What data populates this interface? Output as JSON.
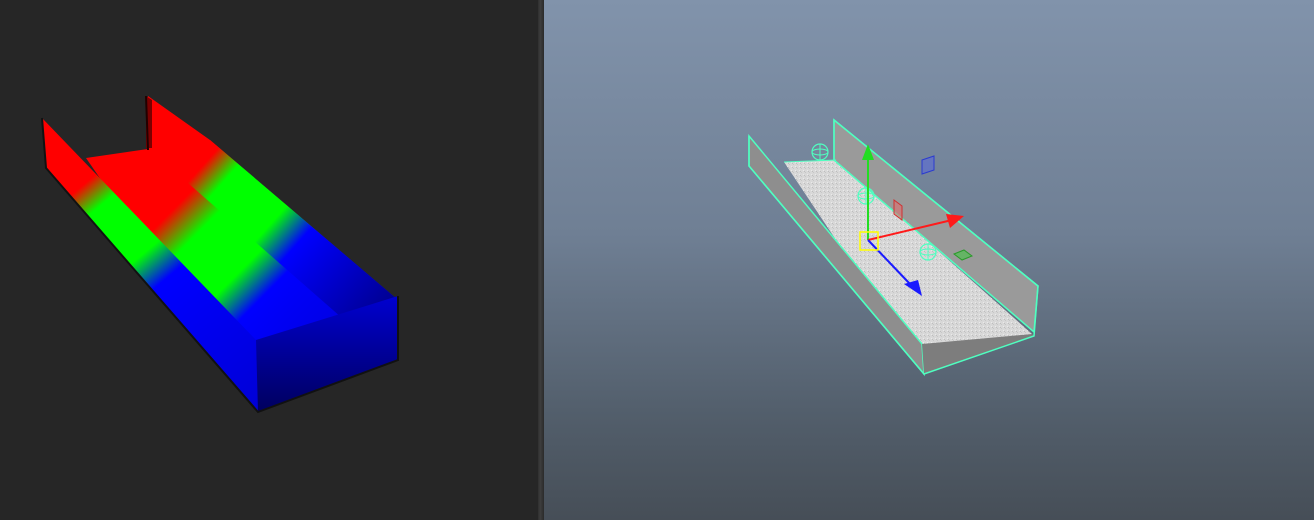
{
  "colors": {
    "left_background": "#262626",
    "right_background_top": "#8193ab",
    "right_background_bottom": "#464e57",
    "selection_highlight": "#4fffc0",
    "axis_x": "#ff1a1a",
    "axis_y": "#22dd22",
    "axis_z": "#1a1aff",
    "pivot": "#ffff00",
    "red_zone": "#ff0000",
    "green_zone": "#00ff00",
    "blue_zone": "#0000ff"
  },
  "icons": {
    "move_manipulator": "move-tool-manipulator-icon",
    "pivot": "pivot-point-icon",
    "constraint_locators": "locator-icon",
    "plane_handles": "plane-handle-icon"
  }
}
